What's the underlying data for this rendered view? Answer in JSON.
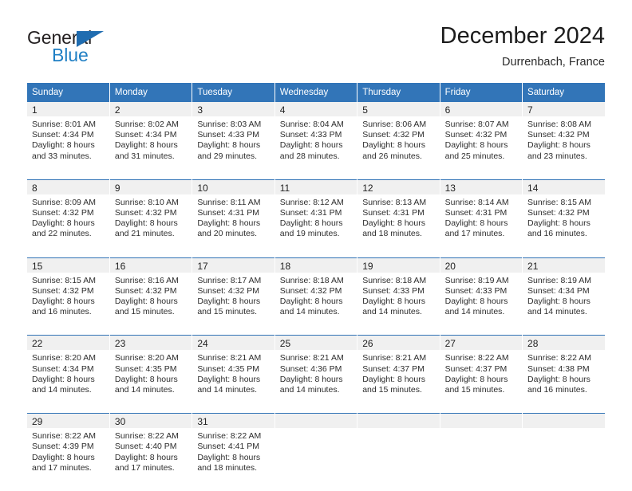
{
  "logo": {
    "word1": "General",
    "word2": "Blue",
    "triangle_color": "#1f6cb0",
    "blue_color": "#1f7fc4"
  },
  "header": {
    "title": "December 2024",
    "subtitle": "Durrenbach, France"
  },
  "theme": {
    "header_blue": "#3275b8",
    "row_divider_blue": "#2f72b5",
    "daynum_band": "#f0f0f0",
    "text": "#2d2d2d"
  },
  "calendar": {
    "weekday_headers": [
      "Sunday",
      "Monday",
      "Tuesday",
      "Wednesday",
      "Thursday",
      "Friday",
      "Saturday"
    ],
    "weeks": [
      [
        {
          "day": "1",
          "l1": "Sunrise: 8:01 AM",
          "l2": "Sunset: 4:34 PM",
          "l3": "Daylight: 8 hours",
          "l4": "and 33 minutes."
        },
        {
          "day": "2",
          "l1": "Sunrise: 8:02 AM",
          "l2": "Sunset: 4:34 PM",
          "l3": "Daylight: 8 hours",
          "l4": "and 31 minutes."
        },
        {
          "day": "3",
          "l1": "Sunrise: 8:03 AM",
          "l2": "Sunset: 4:33 PM",
          "l3": "Daylight: 8 hours",
          "l4": "and 29 minutes."
        },
        {
          "day": "4",
          "l1": "Sunrise: 8:04 AM",
          "l2": "Sunset: 4:33 PM",
          "l3": "Daylight: 8 hours",
          "l4": "and 28 minutes."
        },
        {
          "day": "5",
          "l1": "Sunrise: 8:06 AM",
          "l2": "Sunset: 4:32 PM",
          "l3": "Daylight: 8 hours",
          "l4": "and 26 minutes."
        },
        {
          "day": "6",
          "l1": "Sunrise: 8:07 AM",
          "l2": "Sunset: 4:32 PM",
          "l3": "Daylight: 8 hours",
          "l4": "and 25 minutes."
        },
        {
          "day": "7",
          "l1": "Sunrise: 8:08 AM",
          "l2": "Sunset: 4:32 PM",
          "l3": "Daylight: 8 hours",
          "l4": "and 23 minutes."
        }
      ],
      [
        {
          "day": "8",
          "l1": "Sunrise: 8:09 AM",
          "l2": "Sunset: 4:32 PM",
          "l3": "Daylight: 8 hours",
          "l4": "and 22 minutes."
        },
        {
          "day": "9",
          "l1": "Sunrise: 8:10 AM",
          "l2": "Sunset: 4:32 PM",
          "l3": "Daylight: 8 hours",
          "l4": "and 21 minutes."
        },
        {
          "day": "10",
          "l1": "Sunrise: 8:11 AM",
          "l2": "Sunset: 4:31 PM",
          "l3": "Daylight: 8 hours",
          "l4": "and 20 minutes."
        },
        {
          "day": "11",
          "l1": "Sunrise: 8:12 AM",
          "l2": "Sunset: 4:31 PM",
          "l3": "Daylight: 8 hours",
          "l4": "and 19 minutes."
        },
        {
          "day": "12",
          "l1": "Sunrise: 8:13 AM",
          "l2": "Sunset: 4:31 PM",
          "l3": "Daylight: 8 hours",
          "l4": "and 18 minutes."
        },
        {
          "day": "13",
          "l1": "Sunrise: 8:14 AM",
          "l2": "Sunset: 4:31 PM",
          "l3": "Daylight: 8 hours",
          "l4": "and 17 minutes."
        },
        {
          "day": "14",
          "l1": "Sunrise: 8:15 AM",
          "l2": "Sunset: 4:32 PM",
          "l3": "Daylight: 8 hours",
          "l4": "and 16 minutes."
        }
      ],
      [
        {
          "day": "15",
          "l1": "Sunrise: 8:15 AM",
          "l2": "Sunset: 4:32 PM",
          "l3": "Daylight: 8 hours",
          "l4": "and 16 minutes."
        },
        {
          "day": "16",
          "l1": "Sunrise: 8:16 AM",
          "l2": "Sunset: 4:32 PM",
          "l3": "Daylight: 8 hours",
          "l4": "and 15 minutes."
        },
        {
          "day": "17",
          "l1": "Sunrise: 8:17 AM",
          "l2": "Sunset: 4:32 PM",
          "l3": "Daylight: 8 hours",
          "l4": "and 15 minutes."
        },
        {
          "day": "18",
          "l1": "Sunrise: 8:18 AM",
          "l2": "Sunset: 4:32 PM",
          "l3": "Daylight: 8 hours",
          "l4": "and 14 minutes."
        },
        {
          "day": "19",
          "l1": "Sunrise: 8:18 AM",
          "l2": "Sunset: 4:33 PM",
          "l3": "Daylight: 8 hours",
          "l4": "and 14 minutes."
        },
        {
          "day": "20",
          "l1": "Sunrise: 8:19 AM",
          "l2": "Sunset: 4:33 PM",
          "l3": "Daylight: 8 hours",
          "l4": "and 14 minutes."
        },
        {
          "day": "21",
          "l1": "Sunrise: 8:19 AM",
          "l2": "Sunset: 4:34 PM",
          "l3": "Daylight: 8 hours",
          "l4": "and 14 minutes."
        }
      ],
      [
        {
          "day": "22",
          "l1": "Sunrise: 8:20 AM",
          "l2": "Sunset: 4:34 PM",
          "l3": "Daylight: 8 hours",
          "l4": "and 14 minutes."
        },
        {
          "day": "23",
          "l1": "Sunrise: 8:20 AM",
          "l2": "Sunset: 4:35 PM",
          "l3": "Daylight: 8 hours",
          "l4": "and 14 minutes."
        },
        {
          "day": "24",
          "l1": "Sunrise: 8:21 AM",
          "l2": "Sunset: 4:35 PM",
          "l3": "Daylight: 8 hours",
          "l4": "and 14 minutes."
        },
        {
          "day": "25",
          "l1": "Sunrise: 8:21 AM",
          "l2": "Sunset: 4:36 PM",
          "l3": "Daylight: 8 hours",
          "l4": "and 14 minutes."
        },
        {
          "day": "26",
          "l1": "Sunrise: 8:21 AM",
          "l2": "Sunset: 4:37 PM",
          "l3": "Daylight: 8 hours",
          "l4": "and 15 minutes."
        },
        {
          "day": "27",
          "l1": "Sunrise: 8:22 AM",
          "l2": "Sunset: 4:37 PM",
          "l3": "Daylight: 8 hours",
          "l4": "and 15 minutes."
        },
        {
          "day": "28",
          "l1": "Sunrise: 8:22 AM",
          "l2": "Sunset: 4:38 PM",
          "l3": "Daylight: 8 hours",
          "l4": "and 16 minutes."
        }
      ],
      [
        {
          "day": "29",
          "l1": "Sunrise: 8:22 AM",
          "l2": "Sunset: 4:39 PM",
          "l3": "Daylight: 8 hours",
          "l4": "and 17 minutes."
        },
        {
          "day": "30",
          "l1": "Sunrise: 8:22 AM",
          "l2": "Sunset: 4:40 PM",
          "l3": "Daylight: 8 hours",
          "l4": "and 17 minutes."
        },
        {
          "day": "31",
          "l1": "Sunrise: 8:22 AM",
          "l2": "Sunset: 4:41 PM",
          "l3": "Daylight: 8 hours",
          "l4": "and 18 minutes."
        },
        {
          "day": "",
          "l1": "",
          "l2": "",
          "l3": "",
          "l4": ""
        },
        {
          "day": "",
          "l1": "",
          "l2": "",
          "l3": "",
          "l4": ""
        },
        {
          "day": "",
          "l1": "",
          "l2": "",
          "l3": "",
          "l4": ""
        },
        {
          "day": "",
          "l1": "",
          "l2": "",
          "l3": "",
          "l4": ""
        }
      ]
    ]
  }
}
